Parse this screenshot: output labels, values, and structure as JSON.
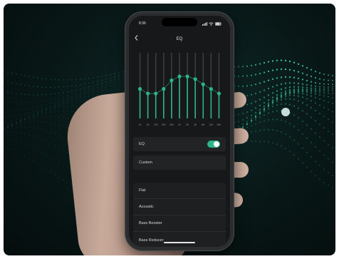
{
  "status": {
    "time": "8:36",
    "signal": "signal-icon",
    "wifi": "wifi-icon",
    "battery": "battery-icon"
  },
  "nav": {
    "title": "EQ",
    "back_icon": "chevron-left-icon"
  },
  "eq": {
    "accent": "#2db489",
    "bands": [
      {
        "label": "31",
        "level": 0.45
      },
      {
        "label": "62",
        "level": 0.38
      },
      {
        "label": "125",
        "level": 0.38
      },
      {
        "label": "250",
        "level": 0.45
      },
      {
        "label": "500",
        "level": 0.58
      },
      {
        "label": "1K",
        "level": 0.64
      },
      {
        "label": "2K",
        "level": 0.64
      },
      {
        "label": "4K",
        "level": 0.6
      },
      {
        "label": "8K",
        "level": 0.52
      },
      {
        "label": "12K",
        "level": 0.45
      },
      {
        "label": "16K",
        "level": 0.38
      }
    ]
  },
  "eq_toggle": {
    "label": "EQ",
    "on": true
  },
  "current_preset": "Custom",
  "presets": [
    "Flat",
    "Acoustic",
    "Bass Booster",
    "Bass Reducer"
  ]
}
